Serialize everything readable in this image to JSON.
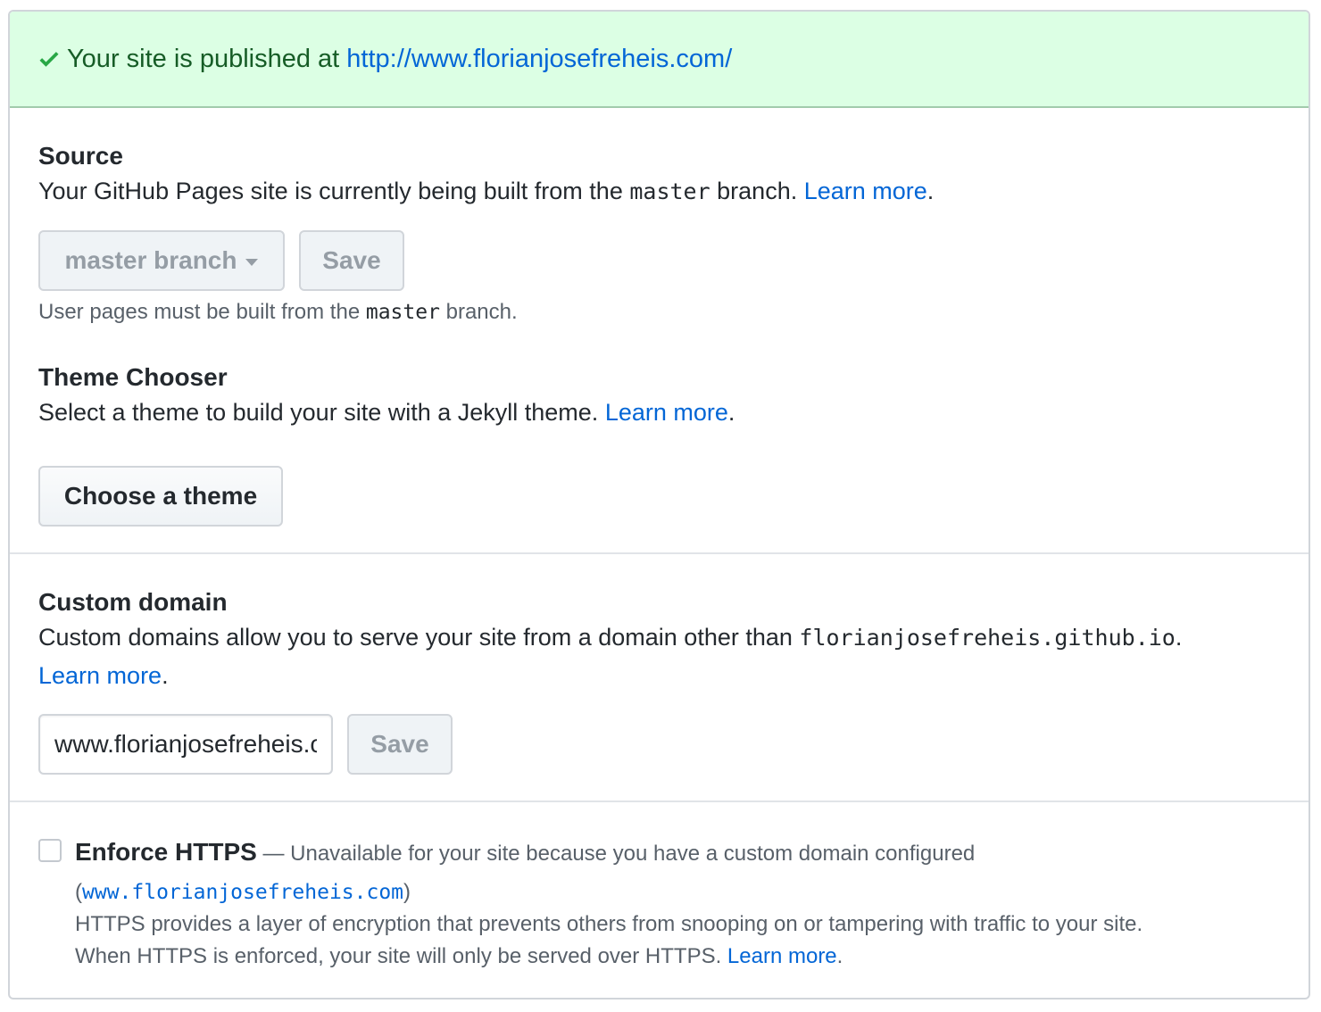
{
  "flash": {
    "icon": "check-icon",
    "prefix": "Your site is published at ",
    "url": "http://www.florianjosefreheis.com/"
  },
  "source": {
    "title": "Source",
    "desc_before": "Your GitHub Pages site is currently being built from the ",
    "desc_code": "master",
    "desc_after": " branch. ",
    "learn_more": "Learn more",
    "period": ".",
    "branch_select": "master branch",
    "save": "Save",
    "note_before": "User pages must be built from the ",
    "note_code": "master",
    "note_after": " branch."
  },
  "theme": {
    "title": "Theme Chooser",
    "desc": "Select a theme to build your site with a Jekyll theme. ",
    "learn_more": "Learn more",
    "period": ".",
    "choose": "Choose a theme"
  },
  "domain": {
    "title": "Custom domain",
    "desc_before": "Custom domains allow you to serve your site from a domain other than ",
    "desc_code": "florianjosefreheis.github.io",
    "desc_after": ".",
    "learn_more": "Learn more",
    "period": ".",
    "input_value": "www.florianjosefreheis.com",
    "save": "Save"
  },
  "https": {
    "title": "Enforce HTTPS",
    "dash": " — Unavailable for your site because you have a custom domain configured",
    "paren_open": "(",
    "domain": "www.florianjosefreheis.com",
    "paren_close": ")",
    "line1": "HTTPS provides a layer of encryption that prevents others from snooping on or tampering with traffic to your site.",
    "line2": "When HTTPS is enforced, your site will only be served over HTTPS. ",
    "learn_more": "Learn more",
    "period": "."
  },
  "colors": {
    "flash_bg": "#dcffe4",
    "flash_text": "#165c26",
    "link": "#0366d6",
    "border": "#d1d5da"
  }
}
